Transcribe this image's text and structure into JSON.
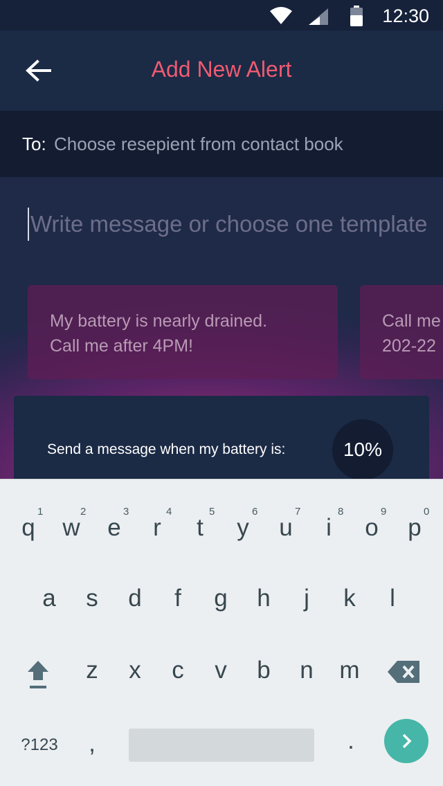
{
  "status_bar": {
    "time": "12:30"
  },
  "app_bar": {
    "title": "Add New Alert"
  },
  "recipient": {
    "label": "To:",
    "placeholder": "Choose resepient from contact book"
  },
  "message": {
    "placeholder": "Write message or choose one template"
  },
  "templates": [
    {
      "line1": "My battery is nearly drained.",
      "line2": "Call me after 4PM!"
    },
    {
      "line1": "Call me",
      "line2": "202-22"
    }
  ],
  "battery_alert": {
    "label": "Send a message when  my battery is:",
    "threshold": "10%"
  },
  "keyboard": {
    "row1": [
      {
        "key": "q",
        "hint": "1"
      },
      {
        "key": "w",
        "hint": "2"
      },
      {
        "key": "e",
        "hint": "3"
      },
      {
        "key": "r",
        "hint": "4"
      },
      {
        "key": "t",
        "hint": "5"
      },
      {
        "key": "y",
        "hint": "6"
      },
      {
        "key": "u",
        "hint": "7"
      },
      {
        "key": "i",
        "hint": "8"
      },
      {
        "key": "o",
        "hint": "9"
      },
      {
        "key": "p",
        "hint": "0"
      }
    ],
    "row2": [
      "a",
      "s",
      "d",
      "f",
      "g",
      "h",
      "j",
      "k",
      "l"
    ],
    "row3": [
      "z",
      "x",
      "c",
      "v",
      "b",
      "n",
      "m"
    ],
    "symbols_label": "?123",
    "comma": ",",
    "period": "."
  },
  "colors": {
    "accent_title": "#ef5b72",
    "go_button": "#46b6a9",
    "background": "#1b2a45"
  }
}
